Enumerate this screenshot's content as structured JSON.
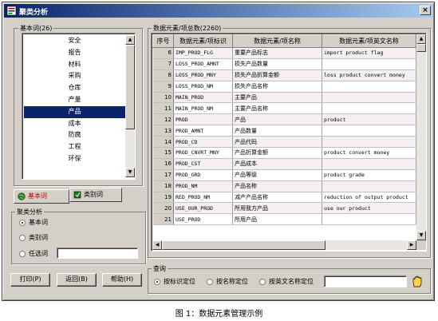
{
  "window": {
    "title": "聚类分析",
    "close_label": "×"
  },
  "left": {
    "basic_group_label": "基本词(26)",
    "basic_items": [
      "安全",
      "报告",
      "材料",
      "采购",
      "仓库",
      "产量",
      "产品",
      "成本",
      "防腐",
      "工程",
      "环保"
    ],
    "selected_item": "产品",
    "tabs": [
      {
        "label": "基本词",
        "active": true
      },
      {
        "label": "类别词",
        "active": false
      }
    ],
    "cluster_group_label": "聚类分析",
    "cluster_options": [
      {
        "label": "基本词",
        "checked": true
      },
      {
        "label": "类别词",
        "checked": false
      },
      {
        "label": "任选词",
        "checked": false
      }
    ],
    "optional_word_value": "",
    "buttons": {
      "print": "打印(P)",
      "back": "返回(B)",
      "help": "帮助(H)"
    }
  },
  "right": {
    "group_label": "数据元素/项总数(2260)",
    "columns": [
      "序号",
      "数据元素/项标识",
      "数据元素/项名称",
      "数据元素/项英文名称"
    ],
    "rows": [
      {
        "no": "6",
        "id": "IMP_PROD_FLG",
        "name": "重要产品标志",
        "en": "import product flag"
      },
      {
        "no": "7",
        "id": "LOSS_PROD_AMNT",
        "name": "损失产品数量",
        "en": ""
      },
      {
        "no": "8",
        "id": "LOSS_PROD_MNY",
        "name": "损失产品折算金额",
        "en": "loss product convert money"
      },
      {
        "no": "9",
        "id": "LOSS_PROD_NM",
        "name": "损失产品名称",
        "en": ""
      },
      {
        "no": "10",
        "id": "MAIN_PROD",
        "name": "主要产品",
        "en": ""
      },
      {
        "no": "11",
        "id": "MAIN_PROD_NM",
        "name": "主要产品名称",
        "en": ""
      },
      {
        "no": "12",
        "id": "PROD",
        "name": "产品",
        "en": "product"
      },
      {
        "no": "13",
        "id": "PROD_AMNT",
        "name": "产品数量",
        "en": ""
      },
      {
        "no": "14",
        "id": "PROD_CD",
        "name": "产品代码",
        "en": ""
      },
      {
        "no": "15",
        "id": "PROD_CNVRT_MNY",
        "name": "产品折算金额",
        "en": "product convert money"
      },
      {
        "no": "16",
        "id": "PROD_CST",
        "name": "产品成本",
        "en": ""
      },
      {
        "no": "17",
        "id": "PROD_GRD",
        "name": "产品等级",
        "en": "product grade"
      },
      {
        "no": "18",
        "id": "PROD_NM",
        "name": "产品名称",
        "en": ""
      },
      {
        "no": "19",
        "id": "RED_PROD_NM",
        "name": "减产产品名称",
        "en": "reduction of output product"
      },
      {
        "no": "20",
        "id": "USE_OUR_PROD",
        "name": "所用我方产品",
        "en": "use our product"
      },
      {
        "no": "21",
        "id": "USE_PROD",
        "name": "所用产品",
        "en": ""
      }
    ],
    "query_group_label": "查询",
    "query_options": [
      {
        "label": "按标识定位",
        "checked": true
      },
      {
        "label": "按名称定位",
        "checked": false
      },
      {
        "label": "按英文名称定位",
        "checked": false
      }
    ],
    "query_value": ""
  },
  "caption": "图 1：数据元素管理示例"
}
